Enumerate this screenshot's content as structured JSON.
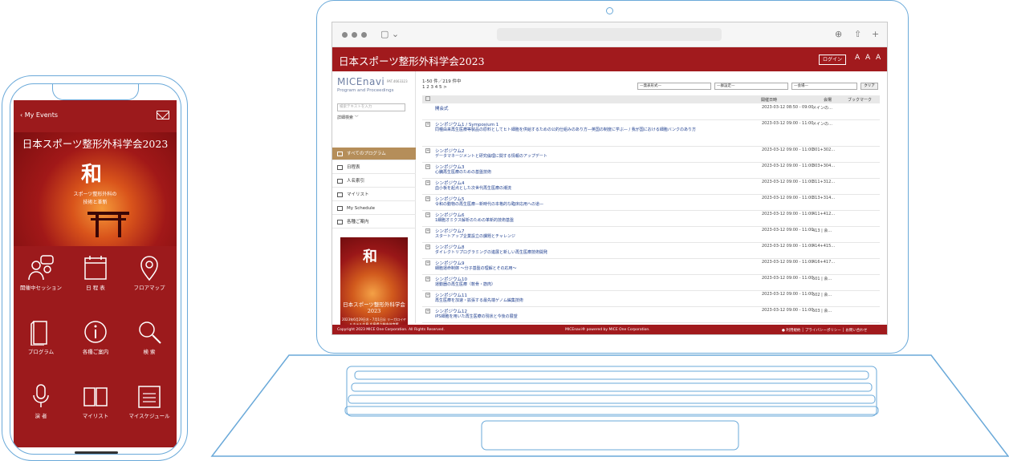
{
  "phone": {
    "back_label": "My Events",
    "hero_title": "日本スポーツ整形外科学会2023",
    "hero_kanji": "和",
    "hero_sub1": "スポーツ整形外科の",
    "hero_sub2": "技術と革新",
    "menu": [
      {
        "label": "開催中セッション",
        "icon": "people-chat-icon"
      },
      {
        "label": "日 程 表",
        "icon": "calendar-icon"
      },
      {
        "label": "フロアマップ",
        "icon": "map-pin-icon"
      },
      {
        "label": "プログラム",
        "icon": "book-icon"
      },
      {
        "label": "各種ご案内",
        "icon": "info-icon"
      },
      {
        "label": "検 索",
        "icon": "search-icon"
      },
      {
        "label": "演 者",
        "icon": "microphone-icon"
      },
      {
        "label": "マイリスト",
        "icon": "open-book-icon"
      },
      {
        "label": "マイスケジュール",
        "icon": "schedule-icon"
      }
    ]
  },
  "browser": {
    "controls": [
      "download-icon",
      "share-icon",
      "plus-icon"
    ]
  },
  "site": {
    "title": "日本スポーツ整形外科学会2023",
    "login_label": "ログイン",
    "font_sizes": "A A A",
    "logo": "MICEnavi",
    "logo_tag": "PAT.4663323",
    "logo_sub": "Program and Proceedings",
    "search_placeholder": "検索テキストを入力",
    "detail_search": "詳細検索 ﹀",
    "sidebar": [
      {
        "label": "すべてのプログラム",
        "active": true
      },
      {
        "label": "日程表",
        "active": false
      },
      {
        "label": "人名索引",
        "active": false
      },
      {
        "label": "マイリスト",
        "active": false
      },
      {
        "label": "My Schedule",
        "active": false
      },
      {
        "label": "各種ご案内",
        "active": false
      }
    ],
    "poster": {
      "kanji": "和",
      "title": "日本スポーツ整形外科学会",
      "year": "2023",
      "details": "2023年6月29日㊍・7月1日㊏ リーガロイヤルホテル広島 広島県立総合体育館"
    },
    "count": "1-50 件／219 件中",
    "pages": "1 2 3 4 5 >",
    "filters": [
      "—発表形式—",
      "—群設定—",
      "—会場—"
    ],
    "clear_label": "クリア",
    "columns": {
      "date": "開催日時",
      "room": "会場",
      "bookmark": "ブックマーク"
    },
    "rows": [
      {
        "t1": "開会式",
        "t2": "",
        "time": "2023-03-12 08:50 - 09:00",
        "room": "メインの…"
      },
      {
        "t1": "シンポジウム1 / Symposium 1",
        "t2": "同種由来再生医療等製品の原料としてヒト細胞を供給するための公的仕組みのあり方—英国の制度に学ぶ— / 我が国における細胞バンクのあり方",
        "time": "2023-03-12 09:00 - 11:00",
        "room": "メインの…"
      },
      {
        "t1": "シンポジウム2",
        "t2": "データマネージメントと研究倫理に関する情報のアップデート",
        "time": "2023-03-12 09:00 - 11:00",
        "room": "301+302…"
      },
      {
        "t1": "シンポジウム3",
        "t2": "心臓再生医療のための基盤技術",
        "time": "2023-03-12 09:00 - 11:00",
        "room": "303+304…"
      },
      {
        "t1": "シンポジウム4",
        "t2": "血小板を起点とした次世代再生医療の潮流",
        "time": "2023-03-12 09:00 - 11:00",
        "room": "311+312…"
      },
      {
        "t1": "シンポジウム5",
        "t2": "令和の動物の再生医療—新時代の本格的な臨床応用への道—",
        "time": "2023-03-12 09:00 - 11:00",
        "room": "313+314…"
      },
      {
        "t1": "シンポジウム6",
        "t2": "1細胞オミクス解析のための革新的技術基盤",
        "time": "2023-03-12 09:00 - 11:00",
        "room": "411+412…"
      },
      {
        "t1": "シンポジウム7",
        "t2": "スタートアップ企業設立の課題とチャレンジ",
        "time": "2023-03-12 09:00 - 11:00",
        "room": "413 | 会…"
      },
      {
        "t1": "シンポジウム8",
        "t2": "ダイレクトリプログラミングの進展と新しい再生医療技術開発",
        "time": "2023-03-12 09:00 - 11:00",
        "room": "414+415…"
      },
      {
        "t1": "シンポジウム9",
        "t2": "細胞運命制御 〜分子基盤の理解とその応用〜",
        "time": "2023-03-12 09:00 - 11:00",
        "room": "416+417…"
      },
      {
        "t1": "シンポジウム10",
        "t2": "運動器の再生医療（軟骨・筋肉）",
        "time": "2023-03-12 09:00 - 11:00",
        "room": "501 | 会…"
      },
      {
        "t1": "シンポジウム11",
        "t2": "再生医療を加速・拡張する最先端ゲノム編集技術",
        "time": "2023-03-12 09:00 - 11:00",
        "room": "502 | 会…"
      },
      {
        "t1": "シンポジウム12",
        "t2": "iPS細胞を用いた再生医療の現状と今後の展望",
        "time": "2023-03-12 09:00 - 11:00",
        "room": "503 | 会…"
      }
    ],
    "footer_left": "Copyright 2023 MICE One Corporation. All Rights Reserved.",
    "footer_mid": "MICEnavi® powered by MICE One Corporation.",
    "footer_right": "● 利用規約 │ プライバシーポリシー │ お問い合わせ"
  }
}
